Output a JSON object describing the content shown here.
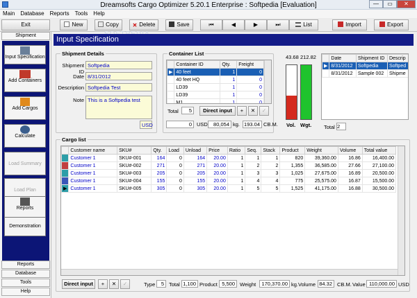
{
  "window": {
    "title": "Dreamsofts Cargo Optimizer 5.20.1 Enterprise : Softpedia [Evaluation]",
    "min": "—",
    "max": "▭",
    "close": "✕"
  },
  "menu": [
    "Main",
    "Database",
    "Reports",
    "Tools",
    "Help"
  ],
  "toolbar": {
    "exit": "Exit",
    "new": "New",
    "copy": "Copy",
    "delete": "Delete",
    "save": "Save",
    "first": "⏮",
    "prev": "◀",
    "next": "▶",
    "last": "⏭",
    "list": "List",
    "import": "Import",
    "export": "Export"
  },
  "watermark": "SOFTPEDIA",
  "sidebar": {
    "tab_top": "Shipment",
    "buttons": [
      "Input Specification",
      "Add Containers",
      "Add Cargos",
      "Calculate",
      "Load Summary",
      "Load Plan",
      "Reports",
      "Demonstration"
    ],
    "tabs_bottom": [
      "Reports",
      "Database",
      "Tools",
      "Help"
    ]
  },
  "header": {
    "title": "Input Specification"
  },
  "shipment": {
    "group": "Shipment Details",
    "id_label": "Shipment ID",
    "id": "Softpedia",
    "date_label": "Date",
    "date": "8/31/2012",
    "desc_label": "Description",
    "desc": "Softpedia Test",
    "note_label": "Note",
    "note": "This is a Softpedia test",
    "currency": "USD"
  },
  "containers": {
    "group": "Container List",
    "headers": [
      "Container ID",
      "Qty.",
      "Freight"
    ],
    "rows": [
      [
        "40 feet",
        "1",
        "0"
      ],
      [
        "40 feet HQ",
        "1",
        "0"
      ],
      [
        "LD39",
        "1",
        "0"
      ],
      [
        "LD39",
        "1",
        "0"
      ],
      [
        "M1",
        "1",
        "0"
      ]
    ],
    "total_label": "Total",
    "total": "5",
    "direct_input": "Direct input",
    "sum_freight": "0",
    "usd": "USD",
    "weight": "80,054",
    "kg": "kg.",
    "volume": "193.04",
    "cbm": "CB.M."
  },
  "gauges": {
    "vol_value": "43.68",
    "wgt_value": "212.82",
    "vol_label": "Vol.",
    "wgt_label": "Wgt.",
    "vol_fill": 0.44,
    "wgt_fill": 1.0
  },
  "shipments_list": {
    "headers": [
      "Date",
      "Shipment ID",
      "Descrip"
    ],
    "rows": [
      [
        "8/31/2012",
        "Softpedia",
        "Softped"
      ],
      [
        "8/31/2012",
        "Sample 002",
        "Shipme"
      ]
    ],
    "total_label": "Total",
    "total": "2"
  },
  "cargo": {
    "group": "Cargo list",
    "headers": [
      "Customer name",
      "SKU#",
      "Qty.",
      "Load",
      "Unload",
      "Price",
      "Ratio",
      "Seq.",
      "Stack",
      "Product",
      "Weight",
      "Volume",
      "Total value"
    ],
    "rows": [
      {
        "color": "#2d9ea8",
        "cells": [
          "Customer 1",
          "SKU#-001",
          "164",
          "0",
          "164",
          "20.00",
          "1",
          "1",
          "1",
          "820",
          "39,360.00",
          "16.86",
          "16,400.00"
        ]
      },
      {
        "color": "#c04040",
        "cells": [
          "Customer 1",
          "SKU#-002",
          "271",
          "0",
          "271",
          "20.00",
          "1",
          "2",
          "2",
          "1,355",
          "36,585.00",
          "27.66",
          "27,100.00"
        ]
      },
      {
        "color": "#2d9ea8",
        "cells": [
          "Customer 1",
          "SKU#-003",
          "205",
          "0",
          "205",
          "20.00",
          "1",
          "3",
          "3",
          "1,025",
          "27,675.00",
          "16.89",
          "20,500.00"
        ]
      },
      {
        "color": "#3a56b8",
        "cells": [
          "Customer 1",
          "SKU#-004",
          "155",
          "0",
          "155",
          "20.00",
          "1",
          "4",
          "4",
          "775",
          "25,575.00",
          "16.87",
          "15,500.00"
        ]
      },
      {
        "color": "#2d9ea8",
        "cells": [
          "Customer 1",
          "SKU#-005",
          "305",
          "0",
          "305",
          "20.00",
          "1",
          "5",
          "5",
          "1,525",
          "41,175.00",
          "16.88",
          "30,500.00"
        ]
      }
    ],
    "direct_input": "Direct input",
    "type_label": "Type",
    "type": "5",
    "total_label": "Total",
    "total": "1,100",
    "product_label": "Product",
    "product": "5,500",
    "weight_label": "Weight",
    "weight": "170,370.00",
    "kg": "kg.",
    "volume_label": "Volume",
    "volume": "84.32",
    "cbm": "CB.M.",
    "value_label": "Value",
    "value": "110,000.00",
    "usd": "USD"
  }
}
